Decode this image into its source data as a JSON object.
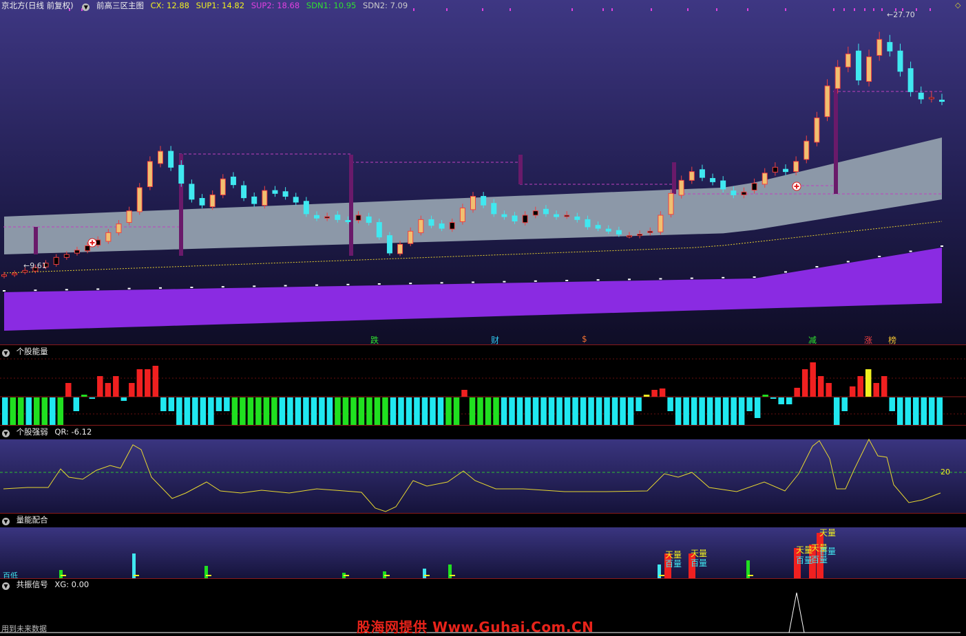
{
  "title_bar": {
    "stock": "京北方(日线 前复权)",
    "indicator": "前高三区主图",
    "values": [
      {
        "label": "CX: 12.88",
        "color": "#f0f020"
      },
      {
        "label": "SUP1: 14.82",
        "color": "#f0f020"
      },
      {
        "label": "SUP2: 18.68",
        "color": "#e040e0"
      },
      {
        "label": "SDN1: 10.95",
        "color": "#30e030"
      },
      {
        "label": "SDN2: 7.09",
        "color": "#cccccc"
      }
    ]
  },
  "main_chart": {
    "low_label": "9.61",
    "high_label": "27.70",
    "event_labels": [
      {
        "text": "跌",
        "color": "#30e030"
      },
      {
        "text": "财",
        "color": "#30c8f0"
      },
      {
        "text": "$",
        "color": "#f07030"
      },
      {
        "text": "减",
        "color": "#30e030"
      },
      {
        "text": "涨",
        "color": "#f04040"
      },
      {
        "text": "榜",
        "color": "#f0c030"
      }
    ]
  },
  "panels": {
    "energy": {
      "title": "个股能量"
    },
    "strength": {
      "title": "个股强弱",
      "value": "QR: -6.12",
      "level_label": "20"
    },
    "volume": {
      "title": "量能配合",
      "labels": [
        "天量",
        "百量",
        "天量",
        "百量",
        "天量",
        "百量",
        "天量",
        "百量",
        "天量",
        "百量",
        "天量"
      ],
      "low_label": "百低"
    },
    "signal": {
      "title": "共振信号",
      "value": "XG: 0.00"
    }
  },
  "footer": {
    "note": "用到未来数据"
  },
  "watermark": "股海网提供 Www.Guhai.Com.CN",
  "colors": {
    "up": "#f04040",
    "down": "#40e8f0",
    "purple_band": "#8a2be2",
    "gray_band": "#8c98a8",
    "energy_green": "#20e020",
    "energy_cyan": "#20e8f0",
    "energy_red": "#f02020"
  },
  "chart_data": [
    {
      "type": "candlestick",
      "title": "前高三区主图",
      "series_labels": [
        "CX",
        "SUP1",
        "SUP2",
        "SDN1",
        "SDN2"
      ],
      "last_values": {
        "CX": 12.88,
        "SUP1": 14.82,
        "SUP2": 18.68,
        "SDN1": 10.95,
        "SDN2": 7.09
      },
      "min_price": 9.61,
      "max_price": 27.7,
      "close": [
        9.8,
        9.9,
        10.1,
        10.3,
        10.6,
        11.0,
        11.2,
        11.5,
        11.8,
        12.2,
        12.7,
        13.3,
        14.2,
        15.8,
        17.6,
        18.3,
        17.2,
        16.1,
        15.0,
        14.6,
        15.3,
        16.4,
        16.0,
        15.1,
        14.7,
        15.6,
        15.4,
        15.2,
        14.8,
        14.0,
        13.7,
        13.8,
        13.6,
        13.5,
        13.9,
        13.4,
        12.4,
        11.3,
        11.9,
        12.8,
        13.6,
        13.2,
        13.0,
        13.4,
        14.4,
        15.2,
        14.6,
        14.0,
        13.8,
        13.5,
        13.9,
        14.2,
        14.0,
        13.8,
        13.9,
        13.6,
        13.1,
        13.0,
        12.8,
        12.6,
        12.5,
        12.6,
        12.8,
        13.9,
        15.4,
        16.3,
        16.9,
        16.5,
        16.2,
        15.7,
        15.3,
        15.5,
        16.1,
        16.8,
        17.2,
        16.9,
        17.6,
        19.0,
        20.6,
        22.8,
        24.1,
        25.0,
        23.2,
        24.8,
        26.0,
        25.2,
        23.8,
        22.4,
        21.9,
        22.0,
        21.8
      ]
    },
    {
      "type": "bar",
      "title": "个股能量",
      "values": [
        -4,
        -4,
        -4,
        -4,
        -4,
        -4,
        -4,
        -4,
        2,
        -2,
        0.3,
        -0.2,
        3,
        2,
        3,
        -0.5,
        2,
        4,
        4,
        4.5,
        -2,
        -2,
        -4,
        -4,
        -4,
        -4,
        -4,
        -2,
        -2,
        -4,
        -4,
        -4,
        -4,
        -4,
        -4,
        -4,
        -4,
        -4,
        -4,
        -4,
        -4,
        -4,
        -4,
        -4,
        -4,
        -4,
        -4,
        -4,
        -4,
        -4,
        -4,
        -4,
        -4,
        -4,
        -4,
        -4,
        -4,
        -4,
        1,
        -4,
        -4,
        -4,
        -4,
        -4,
        -4,
        -4,
        -4,
        -4,
        -4,
        -4,
        -4,
        -4,
        -4,
        -4,
        -4,
        -4,
        -4,
        -4,
        -4,
        -4,
        -2,
        0.3,
        1,
        1.2,
        -2,
        -4,
        -4,
        -4,
        -4,
        -4,
        -4,
        -4,
        -4,
        -4,
        -2,
        -3,
        0.3,
        -0.2,
        -1,
        -1,
        1.3,
        4,
        5,
        3,
        2,
        -4,
        -2,
        1.5,
        3,
        4,
        2,
        3,
        -2,
        -4,
        -4,
        -4,
        -4,
        -4,
        -4
      ]
    },
    {
      "type": "line",
      "title": "个股强弱",
      "ylabel": "QR",
      "reference": 20,
      "last": -6.12
    },
    {
      "type": "bar",
      "title": "量能配合"
    },
    {
      "type": "line",
      "title": "共振信号",
      "last": 0.0
    }
  ]
}
